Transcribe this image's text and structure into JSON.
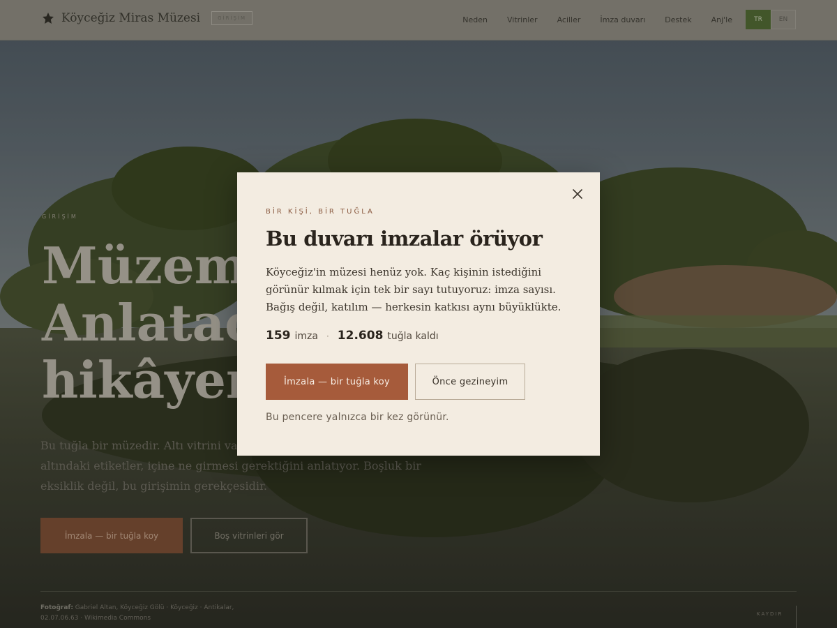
{
  "nav": {
    "brand_name": "Köyceğiz Miras Müzesi",
    "badge": "GİRİŞİM",
    "links": [
      "Neden",
      "Vitrinler",
      "Aciller",
      "İmza duvarı",
      "Destek",
      "Anj'le"
    ],
    "lang": [
      "TR",
      "EN"
    ],
    "active_lang": "TR"
  },
  "hero": {
    "eyebrow": "GİRİŞİM",
    "title": "Müzemiz Anlatacak hikâyemiz",
    "body": "Bu tuğla bir müzedir. Altı vitrini var, ama henüz kurulmadı. Vitrinlerin altındaki etiketler, içine ne girmesi gerektiğini anlatıyor. Boşluk bir eksiklik değil, bu girişimin gerekçesidir.",
    "primary_cta": "İmzala — bir tuğla koy",
    "secondary_cta": "Boş vitrinleri gör",
    "credit_label": "Fotoğraf:",
    "credit_text": "Gabriel Altan, Köyceğiz Gölü · Köyceğiz · Antikalar, 02.07.06.63 · Wikimedia Commons",
    "scroll": "KAYDIR"
  },
  "modal": {
    "eyebrow": "BİR KİŞİ, BİR TUĞLA",
    "title": "Bu duvarı imzalar örüyor",
    "body": "Köyceğiz'in müzesi henüz yok. Kaç kişinin istediğini görünür kılmak için tek bir sayı tutuyoruz: imza sayısı. Bağış değil, katılım — herkesin katkısı aynı büyüklükte.",
    "signatures": "159",
    "signatures_label": "imza",
    "separator": "·",
    "bricks_left": "12.608",
    "bricks_label": "tuğla kaldı",
    "primary_button": "İmzala — bir tuğla koy",
    "secondary_button": "Önce gezineyim",
    "note": "Bu pencere yalnızca bir kez görünür.",
    "close_icon": "close-icon"
  },
  "colors": {
    "accent": "#a65b3b",
    "modal_bg": "#f3ece1",
    "active_lang": "#4f6a32"
  }
}
